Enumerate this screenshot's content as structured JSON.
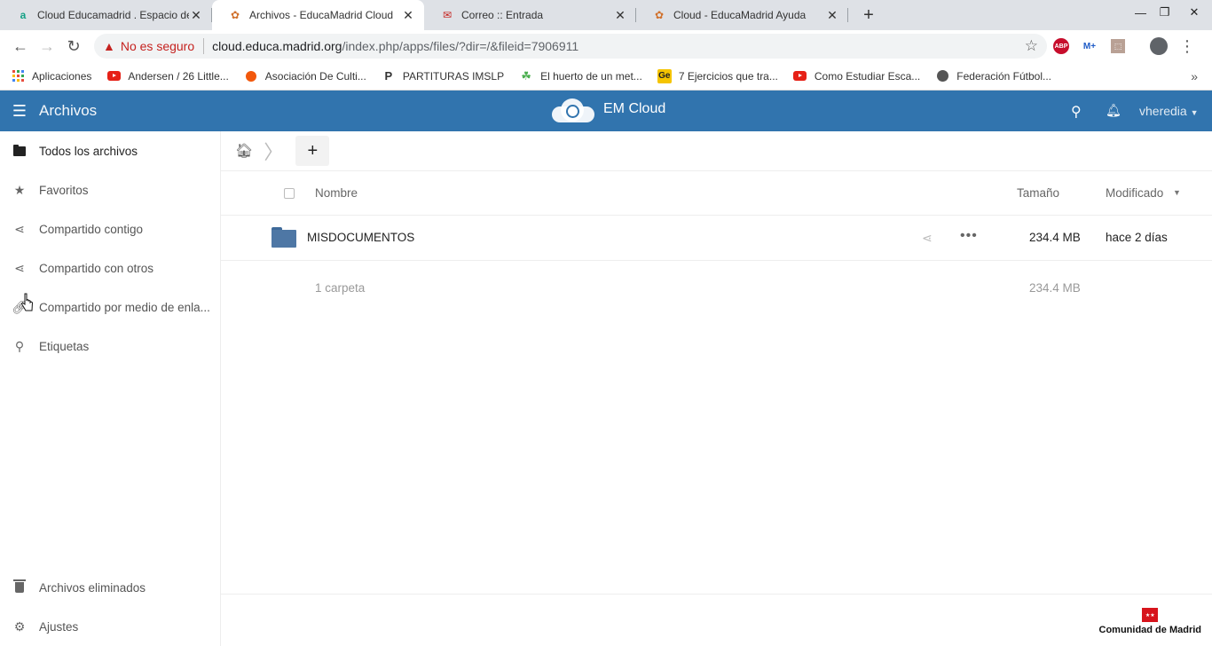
{
  "browser": {
    "tabs": [
      {
        "title": "Cloud Educamadrid . Espacio de",
        "active": false
      },
      {
        "title": "Archivos - EducaMadrid Cloud",
        "active": true
      },
      {
        "title": "Correo :: Entrada",
        "active": false
      },
      {
        "title": "Cloud - EducaMadrid Ayuda",
        "active": false
      }
    ],
    "security_label": "No es seguro",
    "url_host": "cloud.educa.madrid.org",
    "url_path": "/index.php/apps/files/?dir=/&fileid=7906911",
    "extensions": {
      "abp": "ABP",
      "mv": "M+"
    },
    "bookmarks": [
      "Aplicaciones",
      "Andersen / 26 Little...",
      "Asociación De Culti...",
      "PARTITURAS IMSLP",
      "El huerto de un met...",
      "7 Ejercicios que tra...",
      "Como Estudiar Esca...",
      "Federación Fútbol..."
    ]
  },
  "app": {
    "title": "Archivos",
    "brand": "EM Cloud",
    "user": "vheredia",
    "accent": "#3174ae"
  },
  "sidebar": {
    "items": [
      {
        "label": "Todos los archivos",
        "icon": "folder-icon",
        "active": true
      },
      {
        "label": "Favoritos",
        "icon": "star-icon"
      },
      {
        "label": "Compartido contigo",
        "icon": "share-icon"
      },
      {
        "label": "Compartido con otros",
        "icon": "share-icon"
      },
      {
        "label": "Compartido por medio de enla...",
        "icon": "link-icon"
      },
      {
        "label": "Etiquetas",
        "icon": "search-icon"
      }
    ],
    "bottom": {
      "trash": "Archivos eliminados",
      "settings": "Ajustes"
    }
  },
  "files": {
    "columns": {
      "name": "Nombre",
      "size": "Tamaño",
      "modified": "Modificado"
    },
    "rows": [
      {
        "name": "MISDOCUMENTOS",
        "size": "234.4 MB",
        "modified": "hace 2 días"
      }
    ],
    "summary": {
      "text": "1 carpeta",
      "size": "234.4 MB"
    }
  },
  "footer": {
    "brand": "Comunidad de Madrid"
  }
}
